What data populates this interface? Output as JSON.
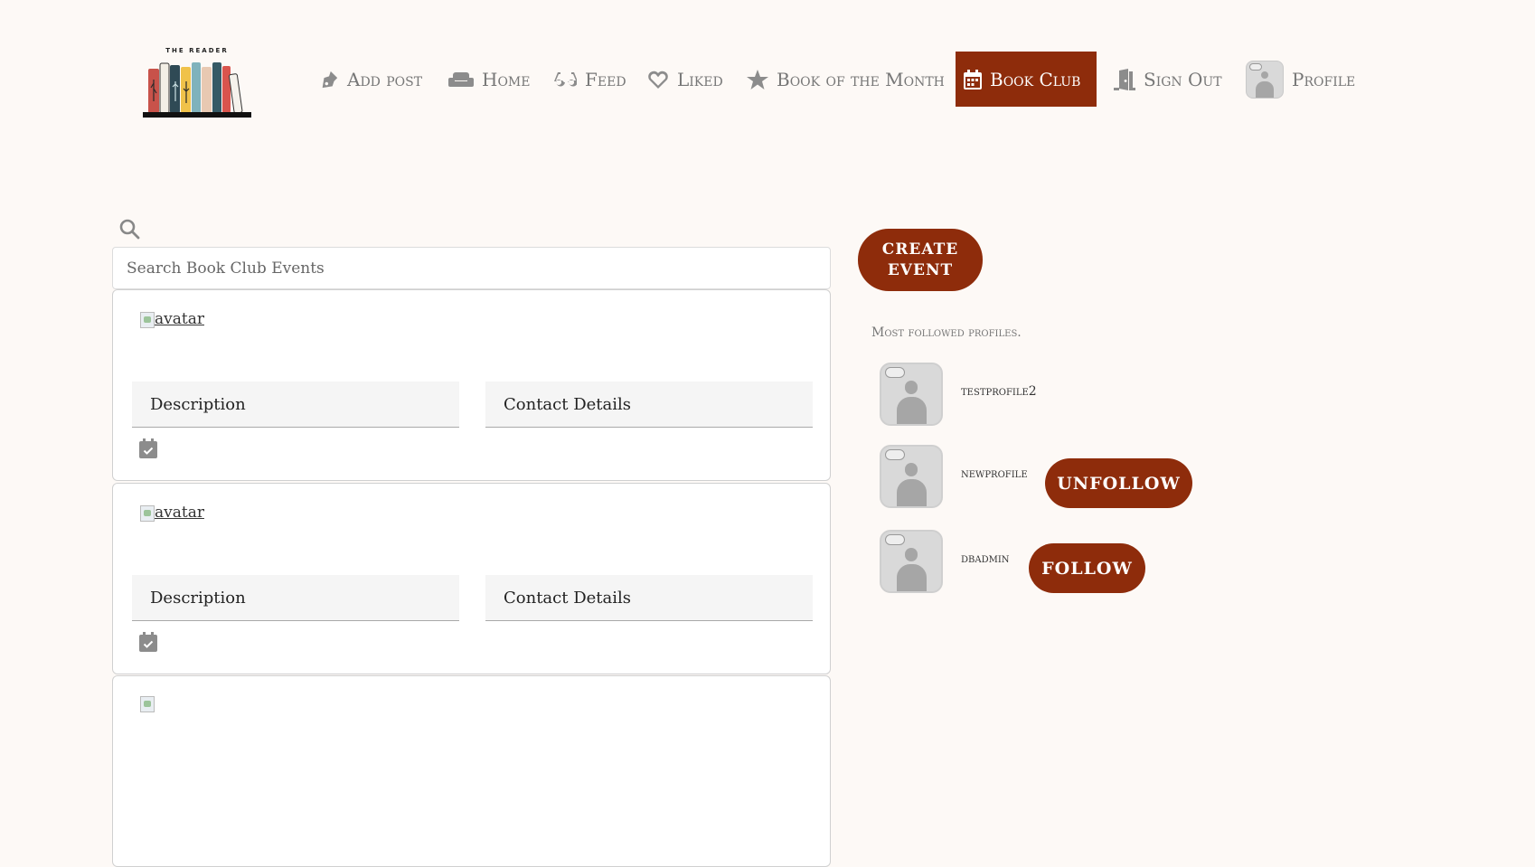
{
  "brand": {
    "logo_text": "THE READER"
  },
  "nav": {
    "items": [
      {
        "label": "Add post",
        "icon": "pen-nib-icon"
      },
      {
        "label": "Home",
        "icon": "couch-icon"
      },
      {
        "label": "Feed",
        "icon": "glasses-icon"
      },
      {
        "label": "Liked",
        "icon": "heart-icon"
      },
      {
        "label": "Book of the Month",
        "icon": "star-icon"
      },
      {
        "label": "Book Club",
        "icon": "calendar-icon",
        "active": true
      },
      {
        "label": "Sign Out",
        "icon": "door-open-icon"
      },
      {
        "label": "Profile",
        "icon": "avatar"
      }
    ]
  },
  "search": {
    "placeholder": "Search Book Club Events"
  },
  "events": [
    {
      "avatar_alt": "avatar",
      "tab_description": "Description",
      "tab_contact": "Contact Details"
    },
    {
      "avatar_alt": "avatar",
      "tab_description": "Description",
      "tab_contact": "Contact Details"
    }
  ],
  "sidebar": {
    "create_event_label": "CREATE EVENT",
    "most_followed_title": "Most followed profiles.",
    "profiles": [
      {
        "name": "testprofile2",
        "button": null
      },
      {
        "name": "newprofile",
        "button": "UNFOLLOW"
      },
      {
        "name": "dbadmin",
        "button": "FOLLOW"
      }
    ]
  },
  "colors": {
    "accent": "#8e2c0b",
    "background": "#fdf9f6",
    "icon_gray": "#8c8c8c"
  }
}
